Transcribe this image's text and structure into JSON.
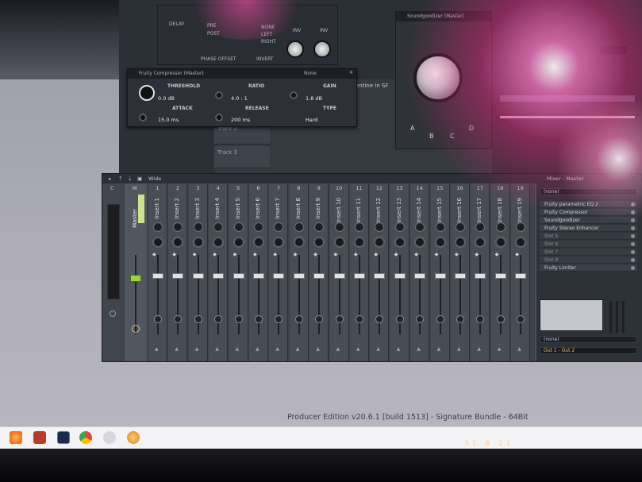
{
  "stereo_shaper": {
    "labels": [
      "DELAY",
      "PRE",
      "POST",
      "NONE",
      "LEFT",
      "RIGHT",
      "INV",
      "INV"
    ],
    "phase_offset": "PHASE OFFSET",
    "invert": "INVERT"
  },
  "compressor": {
    "title": "Fruity Compressor (Master)",
    "preset": "None",
    "threshold_label": "THRESHOLD",
    "threshold_value": "0.0 dB",
    "ratio_label": "RATIO",
    "ratio_value": "4.0 : 1",
    "gain_label": "GAIN",
    "gain_value": "1.8 dB",
    "attack_label": "ATTACK",
    "attack_value": "15.0 ms",
    "release_label": "RELEASE",
    "release_value": "200 ms",
    "type_label": "TYPE",
    "type_value": "Hard"
  },
  "soundgoodizer": {
    "title": "Soundgoodizer (Master)",
    "modes": [
      "A",
      "B",
      "C",
      "D"
    ]
  },
  "playlist": {
    "tracks": [
      "Track 2",
      "Track 3"
    ],
    "header_text": "entine in SF"
  },
  "mixer": {
    "toolbar_label": "Wide",
    "title": "Mixer - Master",
    "cur_label": "C",
    "master_label": "M",
    "master_name": "Master",
    "master_level": 0.55,
    "inserts": [
      {
        "num": "1",
        "name": "Insert 1"
      },
      {
        "num": "2",
        "name": "Insert 2"
      },
      {
        "num": "3",
        "name": "Insert 3"
      },
      {
        "num": "4",
        "name": "Insert 4"
      },
      {
        "num": "5",
        "name": "Insert 5"
      },
      {
        "num": "6",
        "name": "Insert 6"
      },
      {
        "num": "7",
        "name": "Insert 7"
      },
      {
        "num": "8",
        "name": "Insert 8"
      },
      {
        "num": "9",
        "name": "Insert 9"
      },
      {
        "num": "10",
        "name": "Insert 10"
      },
      {
        "num": "11",
        "name": "Insert 11"
      },
      {
        "num": "12",
        "name": "Insert 12"
      },
      {
        "num": "13",
        "name": "Insert 13"
      },
      {
        "num": "14",
        "name": "Insert 14"
      },
      {
        "num": "15",
        "name": "Insert 15"
      },
      {
        "num": "16",
        "name": "Insert 16"
      },
      {
        "num": "17",
        "name": "Insert 17"
      },
      {
        "num": "18",
        "name": "Insert 18"
      },
      {
        "num": "19",
        "name": "Insert 19"
      }
    ],
    "panel": {
      "preset_select": "(none)",
      "slots": [
        "Fruity parametric EQ 2",
        "Fruity Compressor",
        "Soundgoodizer",
        "Fruity Stereo Enhancer",
        "Slot 5",
        "Slot 6",
        "Slot 7",
        "Slot 8",
        "Fruity Limiter"
      ],
      "empty_slots": [
        4,
        5,
        6,
        7
      ],
      "input_select": "(none)",
      "output_select": "Out 1 - Out 2"
    }
  },
  "status_bar": {
    "text": "Producer Edition v20.6.1 [build 1513] - Signature Bundle - 64Bit"
  },
  "clock": "31 8 21",
  "taskbar": {
    "icons": [
      "firefox-icon",
      "store-icon",
      "photoshop-icon",
      "chrome-icon",
      "app-icon",
      "fl-studio-icon"
    ]
  },
  "colors": {
    "accent_green": "#9ad24a",
    "glare_pink": "#f0287f",
    "mixer_bg": "#474c55"
  }
}
